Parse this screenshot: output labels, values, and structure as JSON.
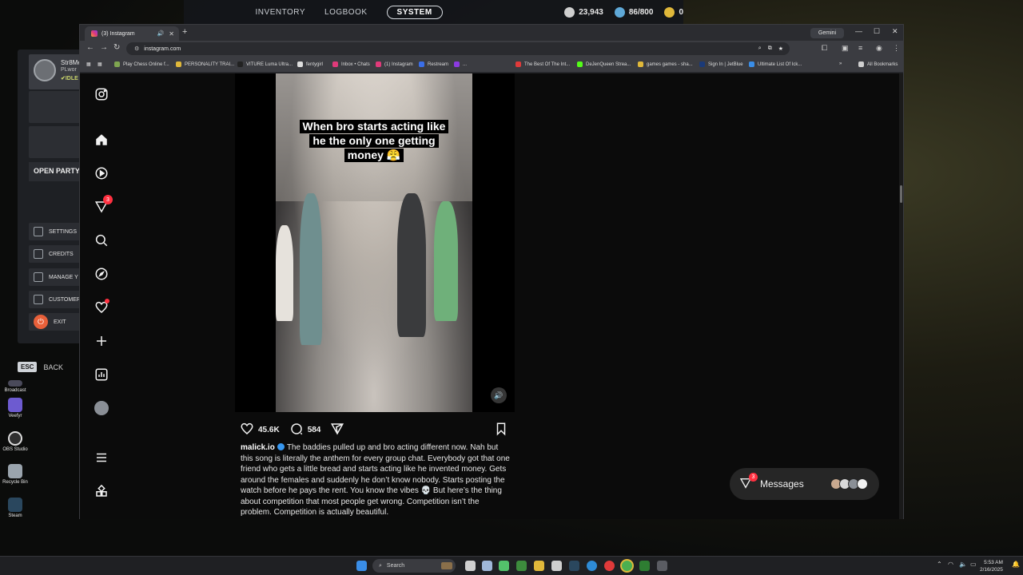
{
  "game": {
    "tabs": [
      "INVENTORY",
      "LOGBOOK",
      "SYSTEM"
    ],
    "active_tab": "SYSTEM",
    "currencies": [
      {
        "value": "23,943",
        "color": "#cfcfcf"
      },
      {
        "value": "86/800",
        "color": "#5fa9d8"
      },
      {
        "value": "0",
        "color": "#e0b83a"
      }
    ],
    "profile": {
      "name": "Str8Me",
      "world": "PLwor",
      "status": "✔IDLE"
    },
    "open_party_label": "OPEN PARTY",
    "menu": [
      {
        "label": "SETTINGS",
        "icon": "gear-icon"
      },
      {
        "label": "CREDITS",
        "icon": "list-icon"
      },
      {
        "label": "MANAGE Y",
        "icon": "edit-icon"
      },
      {
        "label": "CUSTOMER",
        "icon": "chat-icon"
      },
      {
        "label": "EXIT",
        "icon": "power-icon"
      }
    ],
    "esc_key": "ESC",
    "back_label": "BACK"
  },
  "desktop": {
    "icons": [
      {
        "label": "Broadcast",
        "color": "#4a4a5a"
      },
      {
        "label": "Veefyr",
        "color": "#6d5bd0"
      },
      {
        "label": "OBS Studio",
        "color": "#303030"
      },
      {
        "label": "Recycle Bin",
        "color": "#9aa4ad"
      },
      {
        "label": "Steam",
        "color": "#1b2838"
      }
    ]
  },
  "browser": {
    "tab_title": "(3) Instagram",
    "url": "instagram.com",
    "gemini_label": "Gemini",
    "bookmarks": [
      {
        "label": "Play Chess Online f...",
        "color": "#7fa650"
      },
      {
        "label": "PERSONALITY TRAI...",
        "color": "#e0b83a"
      },
      {
        "label": "VITURE Luma Ultra...",
        "color": "#222222"
      },
      {
        "label": "fentygirl",
        "color": "#dddddd"
      },
      {
        "label": "Inbox • Chats",
        "color": "#e03a7a"
      },
      {
        "label": "(1) Instagram",
        "color": "#e03a7a"
      },
      {
        "label": "Restream",
        "color": "#3a6ee8"
      },
      {
        "label": "...",
        "color": "#8b3ae0"
      },
      {
        "label": "The Best Of The Int...",
        "color": "#e03a3a"
      },
      {
        "label": "DeJenQueen Strea...",
        "color": "#53fc18"
      },
      {
        "label": "games games - sha...",
        "color": "#e0b83a"
      },
      {
        "label": "Sign In | JetBlue",
        "color": "#1b3a78"
      },
      {
        "label": "Ultimate List Of Ick...",
        "color": "#3a8ee8"
      }
    ],
    "all_bookmarks": "All Bookmarks"
  },
  "instagram": {
    "notifications_badge": "3",
    "video_caption": [
      "When bro starts acting like",
      "he the only one getting",
      "money 😤"
    ],
    "likes": "45.6K",
    "comments": "584",
    "post_username": "malick.io",
    "post_caption": "The baddies pulled up and bro acting different now. Nah but this song is literally the anthem for every group chat. Everybody got that one friend who gets a little bread and starts acting like he invented money. Gets around the females and suddenly he don’t know nobody. Starts posting the watch before he pays the rent. You know the vibes 💀 But here’s the thing about competition that most people get wrong. Competition isn’t the problem. Competition is actually beautiful.",
    "messages_label": "Messages",
    "messages_badge": "3"
  },
  "taskbar": {
    "search_placeholder": "Search",
    "time": "5:53 AM",
    "date": "2/16/2025"
  }
}
